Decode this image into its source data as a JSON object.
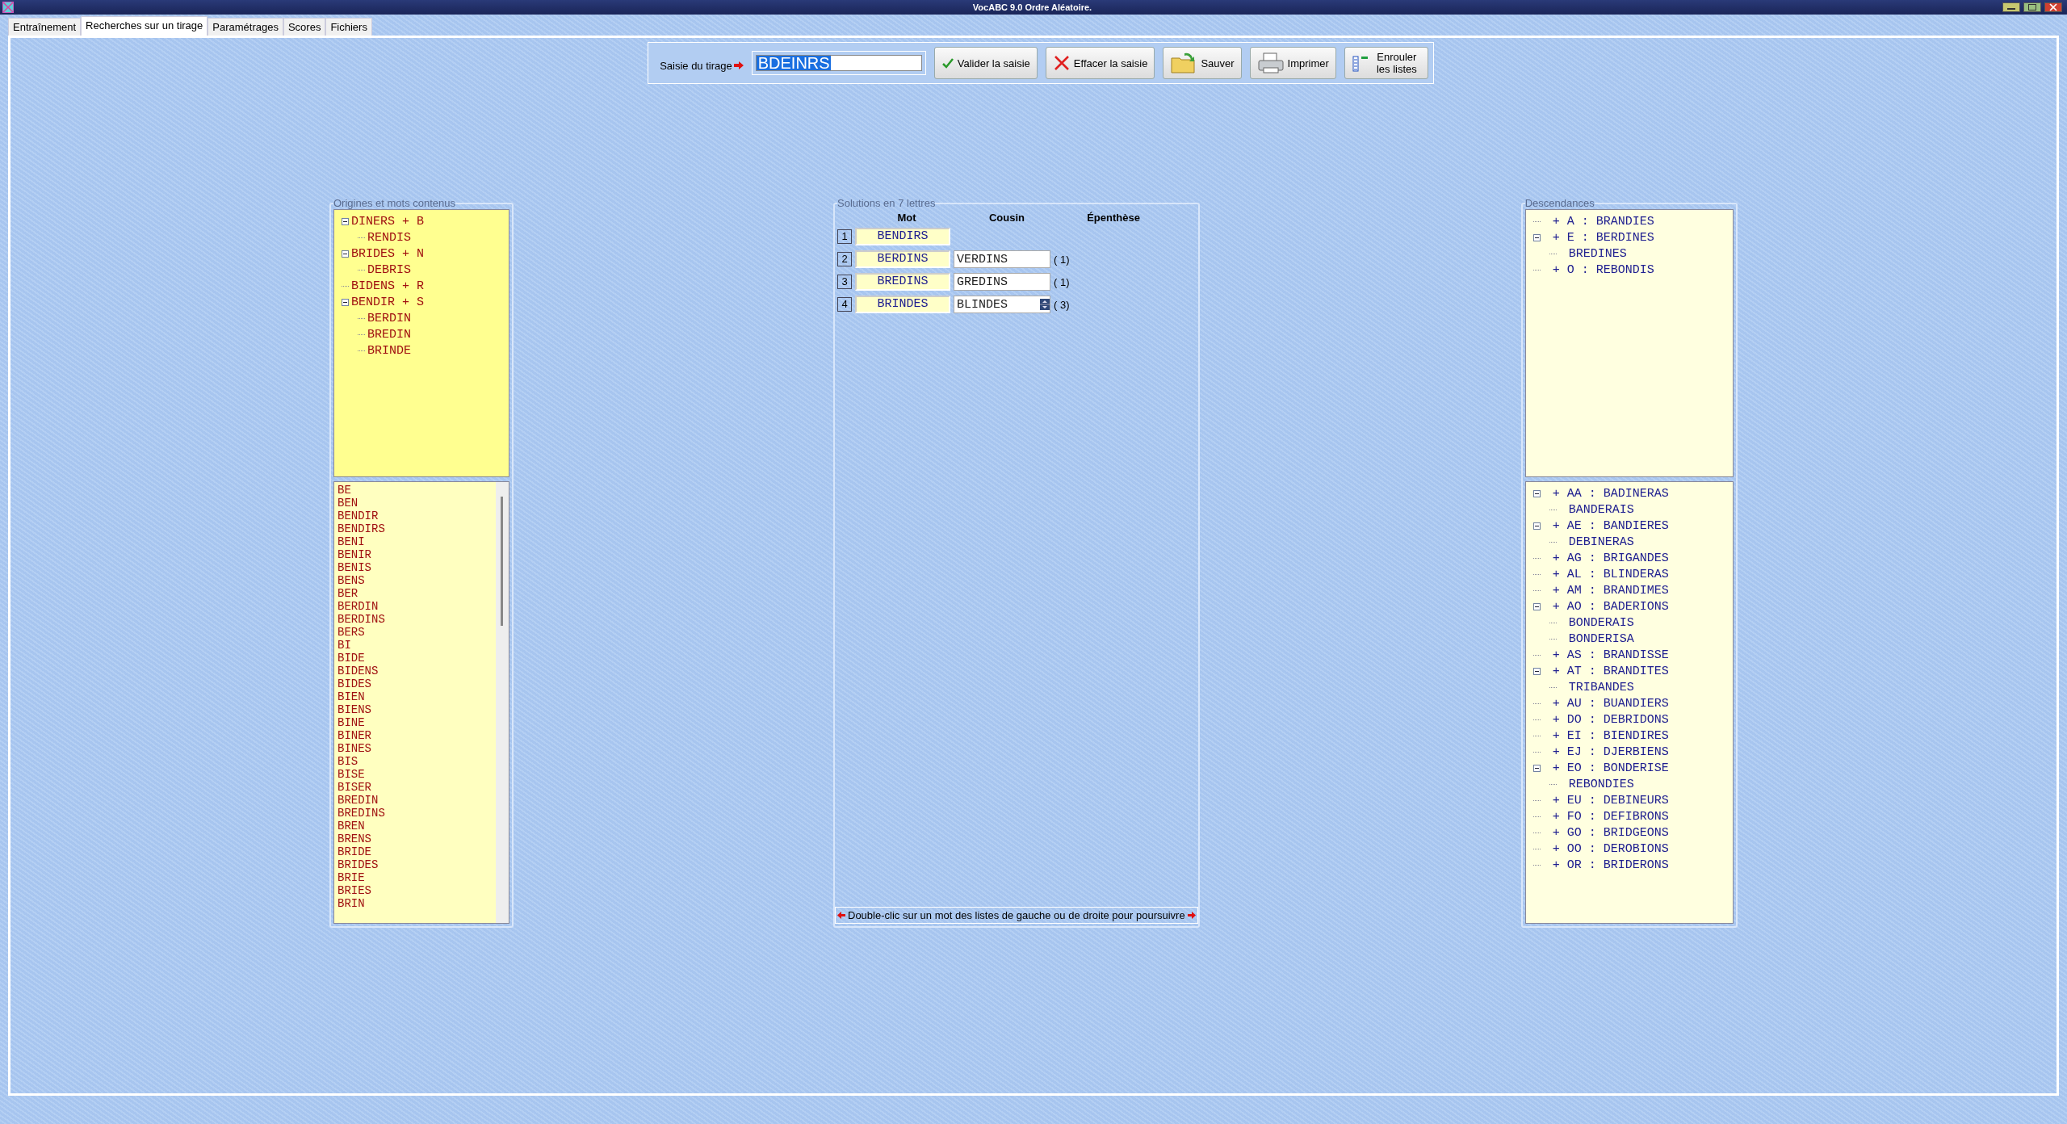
{
  "window": {
    "title": "VocABC 9.0 Ordre Aléatoire."
  },
  "tabs": [
    {
      "label": "Entraînement",
      "selected": false
    },
    {
      "label": "Recherches sur un tirage",
      "selected": true
    },
    {
      "label": "Paramétrages",
      "selected": false
    },
    {
      "label": "Scores",
      "selected": false
    },
    {
      "label": "Fichiers",
      "selected": false
    }
  ],
  "toolbar": {
    "label": "Saisie du tirage",
    "value": "BDEINRS",
    "buttons": [
      {
        "kind": "check",
        "label": "Valider la saisie"
      },
      {
        "kind": "cross",
        "label": "Effacer la saisie"
      },
      {
        "kind": "folder",
        "label": "Sauver"
      },
      {
        "kind": "printer",
        "label": "Imprimer"
      },
      {
        "kind": "list",
        "label": "Enrouler les listes"
      }
    ]
  },
  "origins": {
    "title": "Origines et mots contenus",
    "tree": [
      {
        "label": "DINERS + B",
        "expanded": true,
        "children": [
          {
            "label": "RENDIS"
          }
        ]
      },
      {
        "label": "BRIDES + N",
        "expanded": true,
        "children": [
          {
            "label": "DEBRIS"
          }
        ]
      },
      {
        "label": "BIDENS + R"
      },
      {
        "label": "BENDIR + S",
        "expanded": true,
        "children": [
          {
            "label": "BERDIN"
          },
          {
            "label": "BREDIN"
          },
          {
            "label": "BRINDE"
          }
        ]
      }
    ],
    "words": [
      "BE",
      "BEN",
      "BENDIR",
      "BENDIRS",
      "BENI",
      "BENIR",
      "BENIS",
      "BENS",
      "BER",
      "BERDIN",
      "BERDINS",
      "BERS",
      "BI",
      "BIDE",
      "BIDENS",
      "BIDES",
      "BIEN",
      "BIENS",
      "BINE",
      "BINER",
      "BINES",
      "BIS",
      "BISE",
      "BISER",
      "BREDIN",
      "BREDINS",
      "BREN",
      "BRENS",
      "BRIDE",
      "BRIDES",
      "BRIE",
      "BRIES",
      "BRIN"
    ]
  },
  "solutions": {
    "title": "Solutions en 7 lettres",
    "columns": [
      "Mot",
      "Cousin",
      "Épenthèse"
    ],
    "rows": [
      {
        "number": "1",
        "word": "BENDIRS"
      },
      {
        "number": "2",
        "word": "BERDINS",
        "cousin": "VERDINS",
        "count": "( 1)",
        "spinner": false
      },
      {
        "number": "3",
        "word": "BREDINS",
        "cousin": "GREDINS",
        "count": "( 1)",
        "spinner": false
      },
      {
        "number": "4",
        "word": "BRINDES",
        "cousin": "BLINDES",
        "count": "( 3)",
        "spinner": true
      }
    ],
    "hint": "Double-clic sur un mot des listes de gauche ou de droite pour poursuivre"
  },
  "descendants": {
    "title": "Descendances",
    "tree": [
      {
        "label": "+ A : BRANDIES"
      },
      {
        "label": "+ E : BERDINES",
        "expanded": true,
        "children": [
          {
            "label": "BREDINES"
          }
        ]
      },
      {
        "label": "+ O : REBONDIS"
      }
    ],
    "tree2": [
      {
        "label": "+ AA : BADINERAS",
        "expanded": true,
        "children": [
          {
            "label": "BANDERAIS"
          }
        ]
      },
      {
        "label": "+ AE : BANDIERES",
        "expanded": true,
        "children": [
          {
            "label": "DEBINERAS"
          }
        ]
      },
      {
        "label": "+ AG : BRIGANDES"
      },
      {
        "label": "+ AL : BLINDERAS"
      },
      {
        "label": "+ AM : BRANDIMES"
      },
      {
        "label": "+ AO : BADERIONS",
        "expanded": true,
        "children": [
          {
            "label": "BONDERAIS"
          },
          {
            "label": "BONDERISA"
          }
        ]
      },
      {
        "label": "+ AS : BRANDISSE"
      },
      {
        "label": "+ AT : BRANDITES",
        "expanded": true,
        "children": [
          {
            "label": "TRIBANDES"
          }
        ]
      },
      {
        "label": "+ AU : BUANDIERS"
      },
      {
        "label": "+ DO : DEBRIDONS"
      },
      {
        "label": "+ EI : BIENDIRES"
      },
      {
        "label": "+ EJ : DJERBIENS"
      },
      {
        "label": "+ EO : BONDERISE",
        "expanded": true,
        "children": [
          {
            "label": "REBONDIES"
          }
        ]
      },
      {
        "label": "+ EU : DEBINEURS"
      },
      {
        "label": "+ FO : DEFIBRONS"
      },
      {
        "label": "+ GO : BRIDGEONS"
      },
      {
        "label": "+ OO : DEROBIONS"
      },
      {
        "label": "+ OR : BRIDERONS"
      }
    ]
  }
}
